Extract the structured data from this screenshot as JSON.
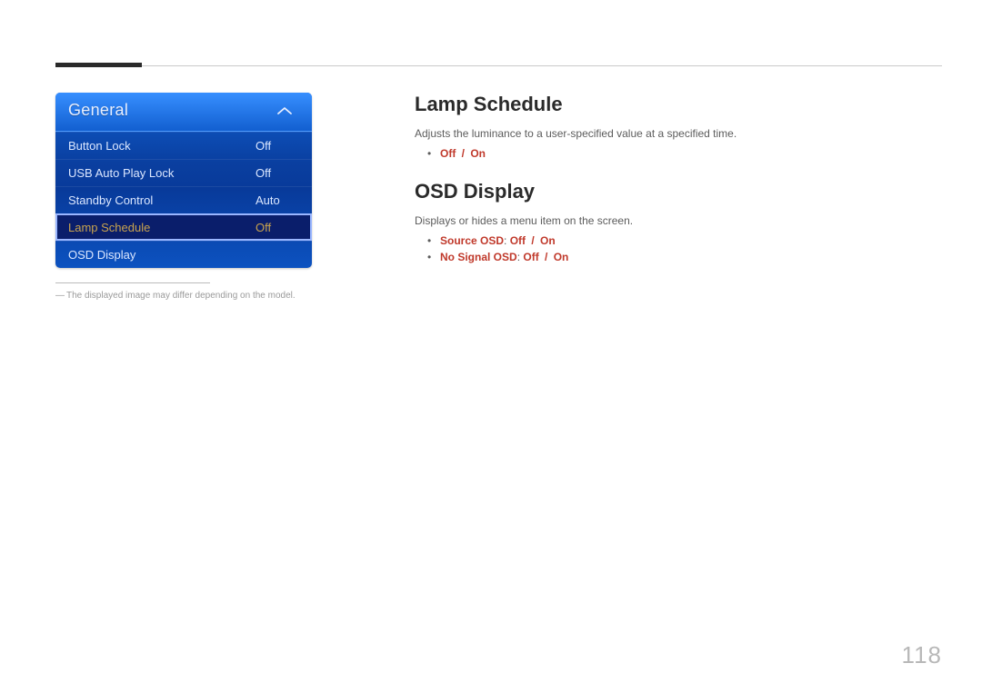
{
  "page_number": "118",
  "osd": {
    "title": "General",
    "rows": [
      {
        "label": "Button Lock",
        "value": "Off",
        "selected": false
      },
      {
        "label": "USB Auto Play Lock",
        "value": "Off",
        "selected": false
      },
      {
        "label": "Standby Control",
        "value": "Auto",
        "selected": false
      },
      {
        "label": "Lamp Schedule",
        "value": "Off",
        "selected": true
      },
      {
        "label": "OSD Display",
        "value": "",
        "selected": false
      }
    ]
  },
  "footnote": "The displayed image may differ depending on the model.",
  "sections": {
    "lamp_schedule": {
      "heading": "Lamp Schedule",
      "description": "Adjusts the luminance to a user-specified value at a specified time.",
      "bullets": [
        {
          "bold_red": "Off",
          "sep": " / ",
          "bold_red_after": "On"
        }
      ]
    },
    "osd_display": {
      "heading": "OSD Display",
      "description": "Displays or hides a menu item on the screen.",
      "bullets": [
        {
          "prefix_red": "Source OSD",
          "colon": ": ",
          "bold_red": "Off",
          "sep": " / ",
          "bold_red_after": "On"
        },
        {
          "prefix_red": "No Signal OSD",
          "colon": ": ",
          "bold_red": "Off",
          "sep": " / ",
          "bold_red_after": "On"
        }
      ]
    }
  }
}
